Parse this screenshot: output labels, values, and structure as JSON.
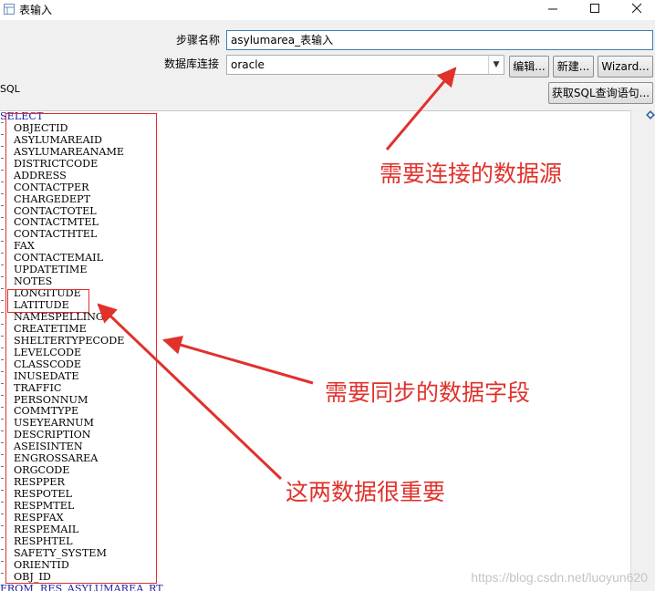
{
  "window": {
    "title": "表输入",
    "icon": "table-input-icon"
  },
  "form": {
    "step_name_label": "步骤名称",
    "step_name_value": "asylumarea_表输入",
    "connection_label": "数据库连接",
    "connection_value": "oracle",
    "edit_button": "编辑...",
    "new_button": "新建...",
    "wizard_button": "Wizard...",
    "get_sql_button": "获取SQL查询语句..."
  },
  "sql": {
    "label": "SQL",
    "keyword": "SELECT",
    "fields": [
      "OBJECTID",
      "ASYLUMAREAID",
      "ASYLUMAREANAME",
      "DISTRICTCODE",
      "ADDRESS",
      "CONTACTPER",
      "CHARGEDEPT",
      "CONTACTOTEL",
      "CONTACTMTEL",
      "CONTACTHTEL",
      "FAX",
      "CONTACTEMAIL",
      "UPDATETIME",
      "NOTES",
      "LONGITUDE",
      "LATITUDE",
      "NAMESPELLING",
      "CREATETIME",
      "SHELTERTYPECODE",
      "LEVELCODE",
      "CLASSCODE",
      "INUSEDATE",
      "TRAFFIC",
      "PERSONNUM",
      "COMMTYPE",
      "USEYEARNUM",
      "DESCRIPTION",
      "ASEISINTEN",
      "ENGROSSAREA",
      "ORGCODE",
      "RESPPER",
      "RESPOTEL",
      "RESPMTEL",
      "RESPFAX",
      "RESPEMAIL",
      "RESPHTEL",
      "SAFETY_SYSTEM",
      "ORIENTID",
      "OBJ_ID"
    ],
    "from_partial": "FROM  RES_ASYLUMAREA_RT"
  },
  "annotations": {
    "connection_note": "需要连接的数据源",
    "fields_note": "需要同步的数据字段",
    "important_note": "这两数据很重要"
  },
  "watermark": "https://blog.csdn.net/luoyun620",
  "colors": {
    "annotation": "#e0312b",
    "keyword": "#1a1aa6",
    "focus_border": "#3c7fb1"
  }
}
